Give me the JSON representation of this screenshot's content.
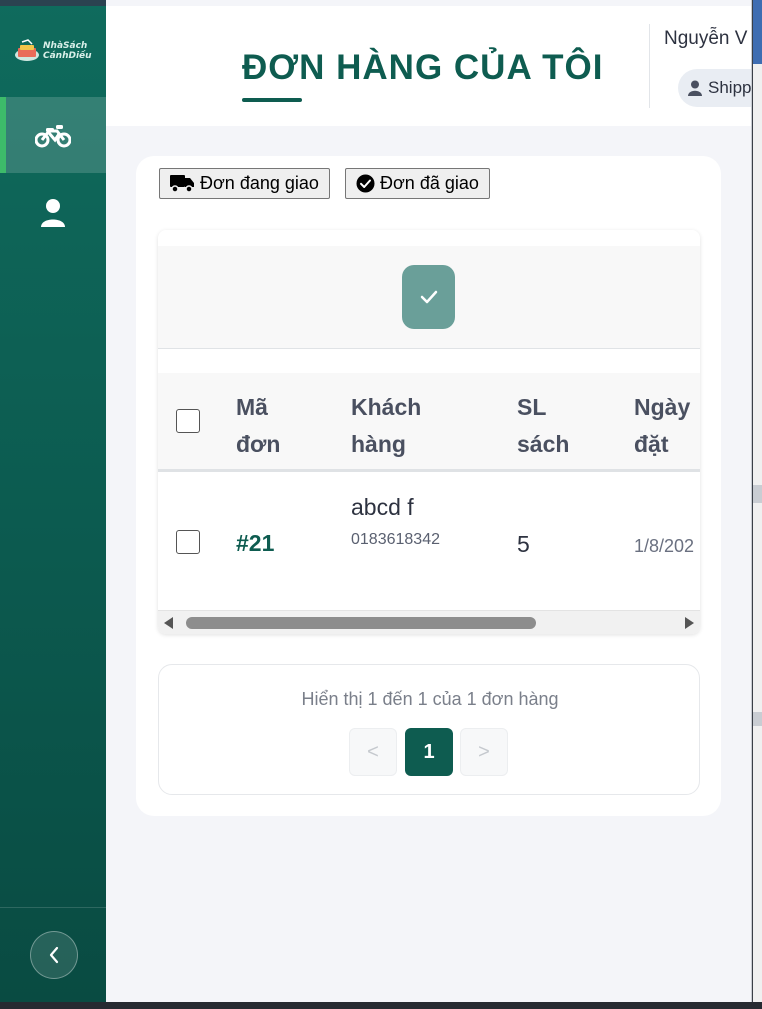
{
  "app": {
    "logo_text_line1": "NhàSách",
    "logo_text_line2": "CánhDiều"
  },
  "sidebar": {
    "items": [
      {
        "name": "motorcycle-icon",
        "active": true
      },
      {
        "name": "user-icon",
        "active": false
      }
    ],
    "collapse_icon": "chevron-left-icon"
  },
  "header": {
    "title": "ĐƠN HÀNG CỦA TÔI",
    "user_name": "Nguyễn V",
    "role": "Shipp"
  },
  "tabs": [
    {
      "label": "Đơn đang giao",
      "icon": "truck-icon"
    },
    {
      "label": "Đơn đã giao",
      "icon": "check-circle-icon"
    }
  ],
  "table": {
    "columns": [
      "Mã\nđơn",
      "Khách\nhàng",
      "SL\nsách",
      "Ngày\nđặt"
    ],
    "column_lines": [
      [
        "Mã",
        "đơn"
      ],
      [
        "Khách",
        "hàng"
      ],
      [
        "SL",
        "sách"
      ],
      [
        "Ngày",
        "đặt"
      ]
    ],
    "rows": [
      {
        "order_id": "#21",
        "customer": "abcd f",
        "phone": "0183618342",
        "qty": "5",
        "date": "1/8/202"
      }
    ]
  },
  "pagination": {
    "info": "Hiển thị 1 đến 1 của 1 đơn hàng",
    "prev": "<",
    "current": "1",
    "next": ">"
  },
  "colors": {
    "primary": "#0e5c50",
    "sidebar_top": "#0f6b5d",
    "active_indicator": "#3dbb6a",
    "toolbar_button": "#6a9f99"
  }
}
